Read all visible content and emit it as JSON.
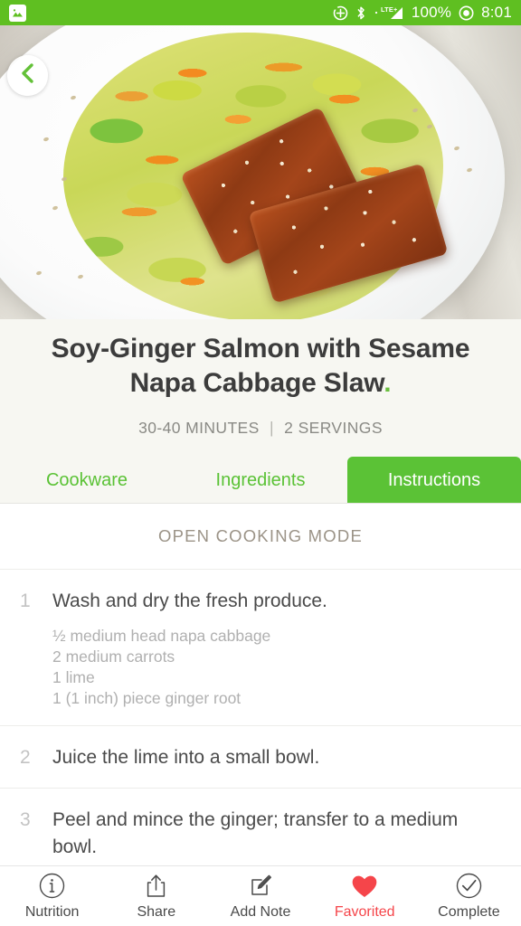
{
  "status_bar": {
    "notification_icon": "image-screenshot-icon",
    "icons": [
      "location-icon",
      "bluetooth-icon",
      "lte-signal-icon",
      "battery-circle-icon"
    ],
    "network_label": "LTE+",
    "battery_percent": "100%",
    "time": "8:01",
    "background_color": "#5FBF21"
  },
  "hero": {
    "image_description": "Soy-ginger glazed salmon fillets with sesame seeds on napa cabbage and carrot slaw, served on a white plate",
    "back_button_icon": "chevron-left-icon"
  },
  "header": {
    "title_main": "Soy-Ginger Salmon with Sesame Napa Cabbage Slaw",
    "title_dot": ".",
    "time_label": "30-40 MINUTES",
    "separator": "|",
    "servings_label": "2 SERVINGS",
    "accent_color": "#5BC236"
  },
  "tabs": [
    {
      "label": "Cookware",
      "active": false
    },
    {
      "label": "Ingredients",
      "active": false
    },
    {
      "label": "Instructions",
      "active": true
    }
  ],
  "content": {
    "cooking_mode_label": "OPEN COOKING MODE",
    "steps": [
      {
        "number": "1",
        "text": "Wash and dry the fresh produce.",
        "ingredients": [
          "½ medium head napa cabbage",
          "2 medium carrots",
          "1 lime",
          "1 (1 inch) piece ginger root"
        ]
      },
      {
        "number": "2",
        "text": "Juice the lime into a small bowl.",
        "ingredients": []
      },
      {
        "number": "3",
        "text": "Peel and mince the ginger; transfer to a medium bowl.",
        "ingredients": []
      }
    ]
  },
  "bottom_bar": [
    {
      "label": "Nutrition",
      "icon": "info-circle-icon",
      "active": false
    },
    {
      "label": "Share",
      "icon": "share-icon",
      "active": false
    },
    {
      "label": "Add Note",
      "icon": "note-pencil-icon",
      "active": false
    },
    {
      "label": "Favorited",
      "icon": "heart-filled-icon",
      "active": true,
      "color": "#F5454A"
    },
    {
      "label": "Complete",
      "icon": "check-circle-icon",
      "active": false
    }
  ]
}
